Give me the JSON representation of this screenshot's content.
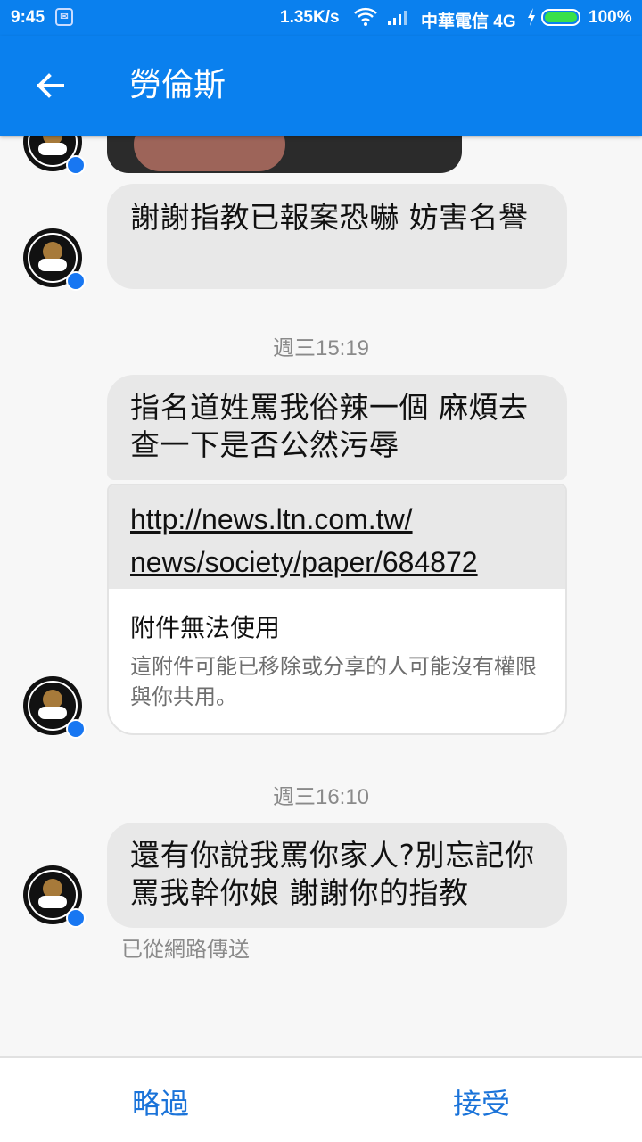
{
  "status_bar": {
    "time": "9:45",
    "speed": "1.35K/s",
    "carrier": "中華電信 4G",
    "battery": "100%",
    "battery_level": 1.0
  },
  "header": {
    "title": "勞倫斯"
  },
  "messages": [
    {
      "text": "謝謝指教已報案恐嚇 妨害名譽"
    },
    {
      "timestamp": "週三15:19"
    },
    {
      "text": "指名道姓罵我俗辣一個 麻煩去查一下是否公然污辱"
    },
    {
      "link": "http://news.ltn.com.tw/news/society/paper/684872",
      "link_line1": "http://news.ltn.com.tw/",
      "link_line2": "news/society/paper/684872",
      "attachment_title": "附件無法使用",
      "attachment_desc": "這附件可能已移除或分享的人可能沒有權限與你共用。"
    },
    {
      "timestamp": "週三16:10"
    },
    {
      "text": "還有你說我罵你家人?別忘記你罵我幹你娘 謝謝你的指教",
      "status": "已從網路傳送"
    }
  ],
  "actions": {
    "ignore": "略過",
    "accept": "接受"
  },
  "colors": {
    "primary": "#0a80ee",
    "bubble": "#e8e8e8",
    "action": "#1a73d9"
  }
}
